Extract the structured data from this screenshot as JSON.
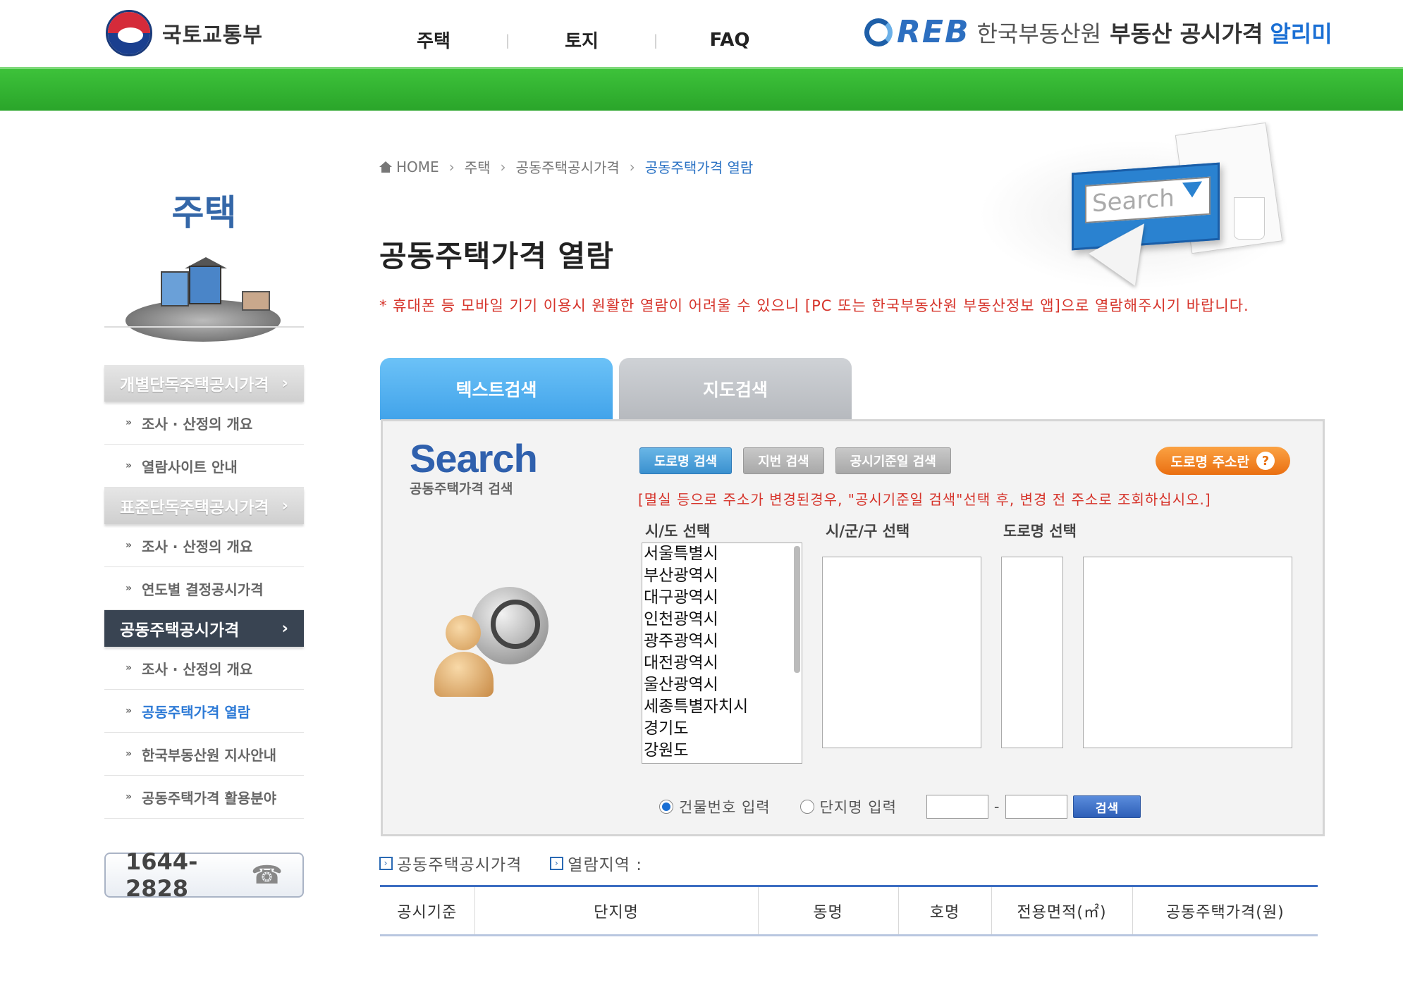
{
  "header": {
    "ministry": "국토교통부",
    "nav": [
      "주택",
      "토지",
      "FAQ"
    ],
    "nav_sep": "|",
    "reb_letters": "REB",
    "reb_name": "한국부동산원",
    "service_name": "부동산 공시가격",
    "service_suffix": "알리미"
  },
  "sidebar": {
    "title": "주택",
    "sections": [
      {
        "label": "개별단독주택공시가격",
        "active": false,
        "items": [
          {
            "label": "조사 · 산정의 개요",
            "active": false
          },
          {
            "label": "열람사이트 안내",
            "active": false
          }
        ]
      },
      {
        "label": "표준단독주택공시가격",
        "active": false,
        "items": [
          {
            "label": "조사 · 산정의 개요",
            "active": false
          },
          {
            "label": "연도별 결정공시가격",
            "active": false
          }
        ]
      },
      {
        "label": "공동주택공시가격",
        "active": true,
        "items": [
          {
            "label": "조사 · 산정의 개요",
            "active": false
          },
          {
            "label": "공동주택가격 열람",
            "active": true
          },
          {
            "label": "한국부동산원 지사안내",
            "active": false
          },
          {
            "label": "공동주택가격 활용분야",
            "active": false
          }
        ]
      }
    ],
    "phone": "1644-2828"
  },
  "breadcrumb": [
    "HOME",
    "주택",
    "공동주택공시가격",
    "공동주택가격 열람"
  ],
  "page_title": "공동주택가격 열람",
  "notice": "* 휴대폰 등 모바일 기기 이용시 원활한 열람이 어려울 수 있으니 [PC 또는 한국부동산원 부동산정보 앱]으로 열람해주시기 바랍니다.",
  "hero_search_text": "Search",
  "tabs": {
    "text": "텍스트검색",
    "map": "지도검색"
  },
  "search": {
    "logo_word": "Search",
    "logo_sub": "공동주택가격 검색",
    "buttons": {
      "road": "도로명 검색",
      "jibun": "지번 검색",
      "date": "공시기준일 검색"
    },
    "road_info": "도로명 주소란",
    "road_info_q": "?",
    "warning": "[멸실 등으로 주소가 변경된경우, \"공시기준일 검색\"선택 후, 변경 전 주소로 조회하십시오.]",
    "labels": {
      "sido": "시/도 선택",
      "sigungu": "시/군/구 선택",
      "road": "도로명 선택"
    },
    "sido_options": [
      "서울특별시",
      "부산광역시",
      "대구광역시",
      "인천광역시",
      "광주광역시",
      "대전광역시",
      "울산광역시",
      "세종특별자치시",
      "경기도",
      "강원도"
    ],
    "radio_building": "건물번호 입력",
    "radio_complex": "단지명 입력",
    "dash": "-",
    "submit": "검색"
  },
  "result": {
    "label1": "공동주택공시가격",
    "label2": "열람지역 :",
    "columns": [
      "공시기준",
      "단지명",
      "동명",
      "호명",
      "전용면적(㎡)",
      "공동주택가격(원)"
    ]
  },
  "colors": {
    "green_band": "#36b834",
    "accent_blue": "#2d7ad6",
    "notice_red": "#d6342b",
    "active_menu": "#394452",
    "tab_active": "#41a3ea"
  }
}
